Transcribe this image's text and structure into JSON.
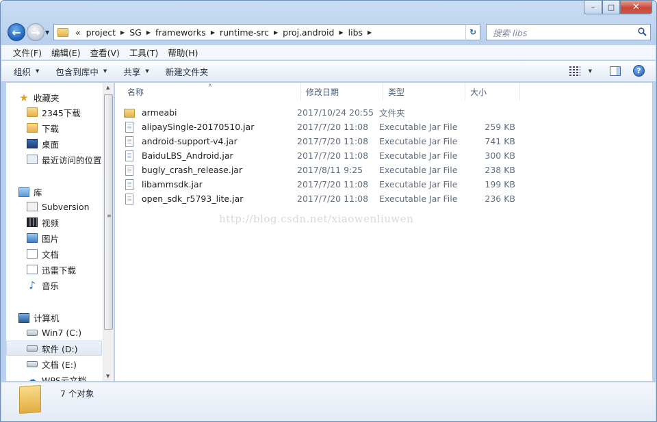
{
  "window": {
    "caption_min": "–",
    "caption_max": "□",
    "caption_close": "✕"
  },
  "address": {
    "overflow": "«",
    "crumbs": [
      "project",
      "SG",
      "frameworks",
      "runtime-src",
      "proj.android",
      "libs"
    ]
  },
  "search": {
    "placeholder": "搜索 libs"
  },
  "menu": [
    "文件(F)",
    "编辑(E)",
    "查看(V)",
    "工具(T)",
    "帮助(H)"
  ],
  "commands": {
    "organize": "组织",
    "include_library": "包含到库中",
    "share": "共享",
    "new_folder": "新建文件夹"
  },
  "nav": {
    "favorites": {
      "label": "收藏夹",
      "items": [
        "2345下载",
        "下载",
        "桌面",
        "最近访问的位置"
      ]
    },
    "libraries": {
      "label": "库",
      "items": [
        "Subversion",
        "视频",
        "图片",
        "文档",
        "迅雷下载",
        "音乐"
      ]
    },
    "computer": {
      "label": "计算机",
      "items": [
        "Win7 (C:)",
        "软件 (D:)",
        "文档 (E:)",
        "WPS云文档"
      ]
    }
  },
  "columns": [
    "名称",
    "修改日期",
    "类型",
    "大小"
  ],
  "files": [
    {
      "name": "armeabi",
      "date": "2017/10/24 20:55",
      "type": "文件夹",
      "size": "",
      "icon": "folder-icon"
    },
    {
      "name": "alipaySingle-20170510.jar",
      "date": "2017/7/20 11:08",
      "type": "Executable Jar File",
      "size": "259 KB",
      "icon": "file-icon"
    },
    {
      "name": "android-support-v4.jar",
      "date": "2017/7/20 11:08",
      "type": "Executable Jar File",
      "size": "741 KB",
      "icon": "file-icon"
    },
    {
      "name": "BaiduLBS_Android.jar",
      "date": "2017/7/20 11:08",
      "type": "Executable Jar File",
      "size": "300 KB",
      "icon": "file-icon"
    },
    {
      "name": "bugly_crash_release.jar",
      "date": "2017/8/11 9:25",
      "type": "Executable Jar File",
      "size": "238 KB",
      "icon": "file-icon"
    },
    {
      "name": "libammsdk.jar",
      "date": "2017/7/20 11:08",
      "type": "Executable Jar File",
      "size": "199 KB",
      "icon": "file-icon"
    },
    {
      "name": "open_sdk_r5793_lite.jar",
      "date": "2017/7/20 11:08",
      "type": "Executable Jar File",
      "size": "236 KB",
      "icon": "file-icon"
    }
  ],
  "watermark": "http://blog.csdn.net/xiaowenliuwen",
  "status": {
    "count": "7 个对象"
  }
}
